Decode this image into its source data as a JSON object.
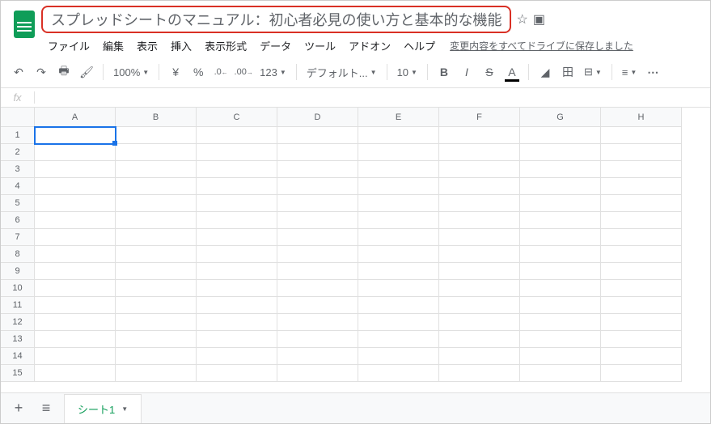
{
  "header": {
    "title": "スプレッドシートのマニュアル：初心者必見の使い方と基本的な機能",
    "save_status": "変更内容をすべてドライブに保存しました"
  },
  "menubar": [
    "ファイル",
    "編集",
    "表示",
    "挿入",
    "表示形式",
    "データ",
    "ツール",
    "アドオン",
    "ヘルプ"
  ],
  "toolbar": {
    "zoom": "100%",
    "currency": "¥",
    "percent": "%",
    "dec_dec": ".0",
    "dec_inc": ".00",
    "more_formats": "123",
    "font": "デフォルト...",
    "font_size": "10"
  },
  "formula_bar": {
    "fx": "fx",
    "value": ""
  },
  "grid": {
    "columns": [
      "A",
      "B",
      "C",
      "D",
      "E",
      "F",
      "G",
      "H"
    ],
    "rows": [
      "1",
      "2",
      "3",
      "4",
      "5",
      "6",
      "7",
      "8",
      "9",
      "10",
      "11",
      "12",
      "13",
      "14",
      "15"
    ],
    "selected": "A1"
  },
  "sheetbar": {
    "active_tab": "シート1"
  }
}
